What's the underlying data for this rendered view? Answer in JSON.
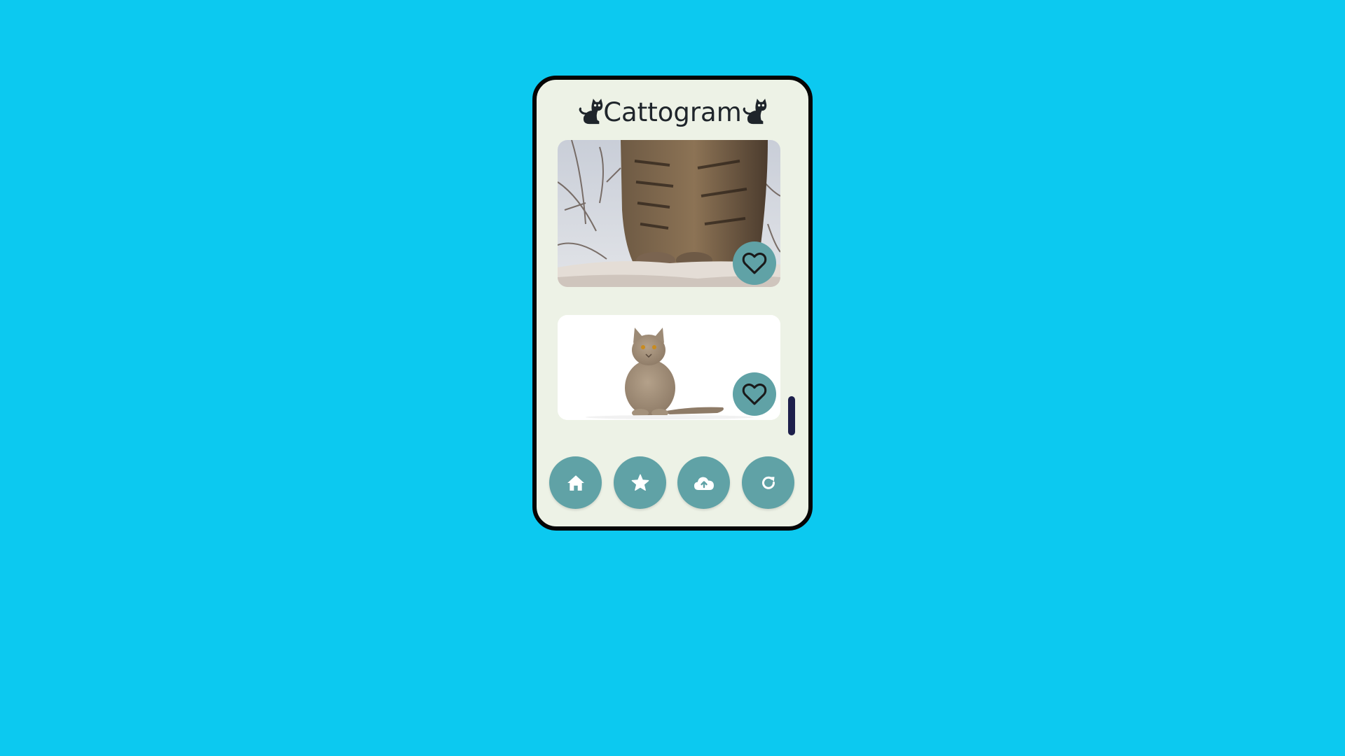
{
  "app": {
    "title": "Cattogram"
  },
  "posts": [
    {
      "photo_icon": "tabby-cat-on-rock-photo",
      "like_icon": "heart-outline-icon"
    },
    {
      "photo_icon": "gray-british-shorthair-cat-photo",
      "like_icon": "heart-outline-icon"
    }
  ],
  "nav": {
    "items": [
      {
        "icon": "home-icon"
      },
      {
        "icon": "star-icon"
      },
      {
        "icon": "cloud-upload-icon"
      },
      {
        "icon": "refresh-icon"
      }
    ]
  },
  "colors": {
    "page_background": "#0cc9f0",
    "phone_background": "#edf2e6",
    "button_teal": "#60a2a6",
    "scroll_thumb": "#1d1f4b",
    "frame": "#050505",
    "text": "#1f252b"
  }
}
